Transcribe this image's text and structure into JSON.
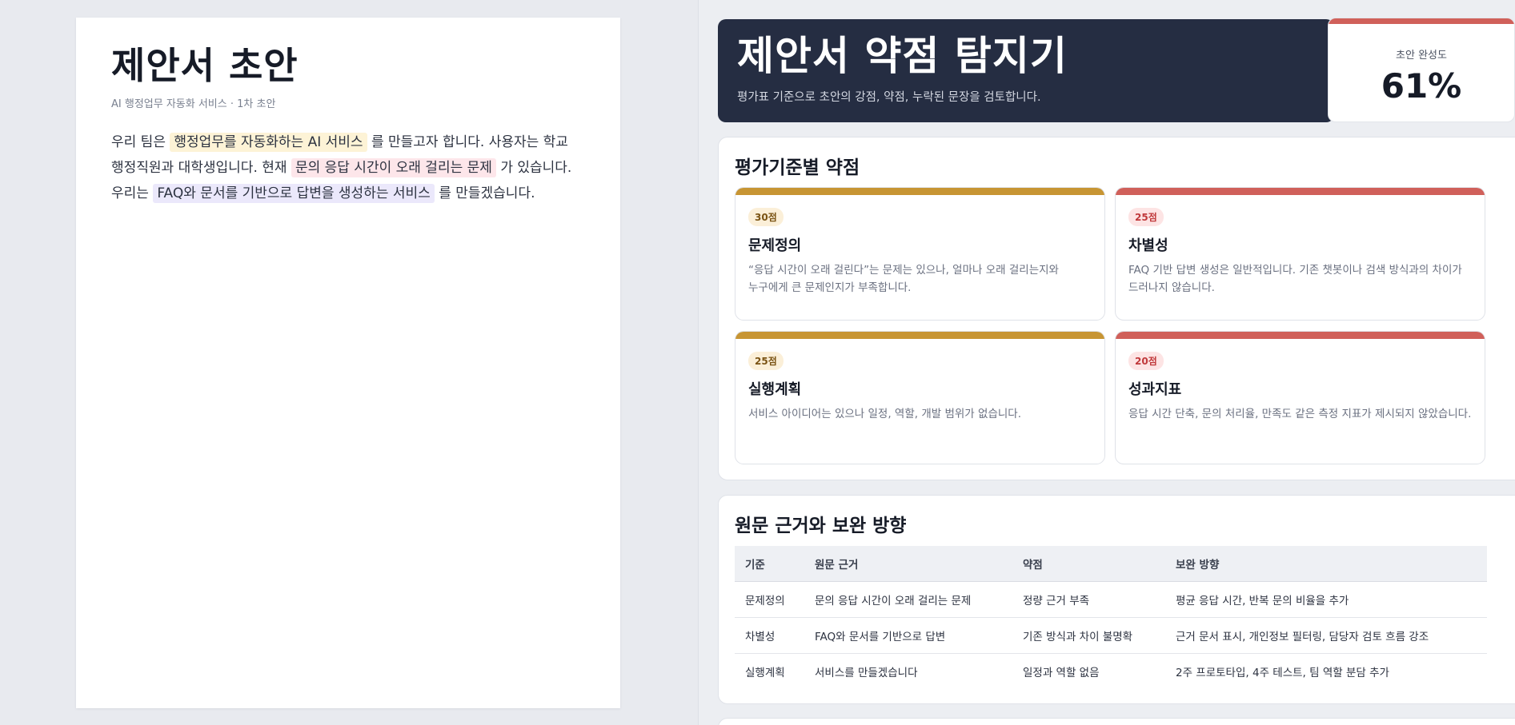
{
  "document": {
    "title": "제안서 초안",
    "subtitle": "AI 행정업무 자동화 서비스 · 1차 초안",
    "body": {
      "t1": "우리 팀은 ",
      "h1": "행정업무를 자동화하는 AI 서비스",
      "t2": " 를 만들고자 합니다. 사용자는 학교 행정직원과 대학생입니다. 현재 ",
      "h2": "문의 응답 시간이 오래 걸리는 문제",
      "t3": " 가 있습니다. 우리는 ",
      "h3": "FAQ와 문서를 기반으로 답변을 생성하는 서비스",
      "t4": " 를 만들겠습니다."
    }
  },
  "hero": {
    "title": "제안서 약점 탐지기",
    "subtitle": "평가표 기준으로 초안의 강점, 약점, 누락된 문장을 검토합니다."
  },
  "completion": {
    "label": "초안 완성도",
    "value": "61%",
    "accent": "#d0605a"
  },
  "weaknesses": {
    "title": "평가기준별 약점",
    "cards": [
      {
        "score": "30점",
        "title": "문제정의",
        "desc": "“응답 시간이 오래 걸린다”는 문제는 있으나, 얼마나 오래 걸리는지와 누구에게 큰 문제인지가 부족합니다.",
        "tone": "gold"
      },
      {
        "score": "25점",
        "title": "차별성",
        "desc": "FAQ 기반 답변 생성은 일반적입니다. 기존 챗봇이나 검색 방식과의 차이가 드러나지 않습니다.",
        "tone": "red"
      },
      {
        "score": "25점",
        "title": "실행계획",
        "desc": "서비스 아이디어는 있으나 일정, 역할, 개발 범위가 없습니다.",
        "tone": "gold"
      },
      {
        "score": "20점",
        "title": "성과지표",
        "desc": "응답 시간 단축, 문의 처리율, 만족도 같은 측정 지표가 제시되지 않았습니다.",
        "tone": "red"
      }
    ]
  },
  "evidence": {
    "title": "원문 근거와 보완 방향",
    "headers": [
      "기준",
      "원문 근거",
      "약점",
      "보완 방향"
    ],
    "rows": [
      [
        "문제정의",
        "문의 응답 시간이 오래 걸리는 문제",
        "정량 근거 부족",
        "평균 응답 시간, 반복 문의 비율을 추가"
      ],
      [
        "차별성",
        "FAQ와 문서를 기반으로 답변",
        "기존 방식과 차이 불명확",
        "근거 문서 표시, 개인정보 필터링, 담당자 검토 흐름 강조"
      ],
      [
        "실행계획",
        "서비스를 만들겠습니다",
        "일정과 역할 없음",
        "2주 프로토타입, 4주 테스트, 팀 역할 분담 추가"
      ]
    ]
  },
  "colors": {
    "navy": "#252d42",
    "gold": "#c79533",
    "red": "#d0605a",
    "highlight_yellow": "#fdf3d6",
    "highlight_pink": "#fde6ea",
    "highlight_purple": "#ebe8fb"
  }
}
